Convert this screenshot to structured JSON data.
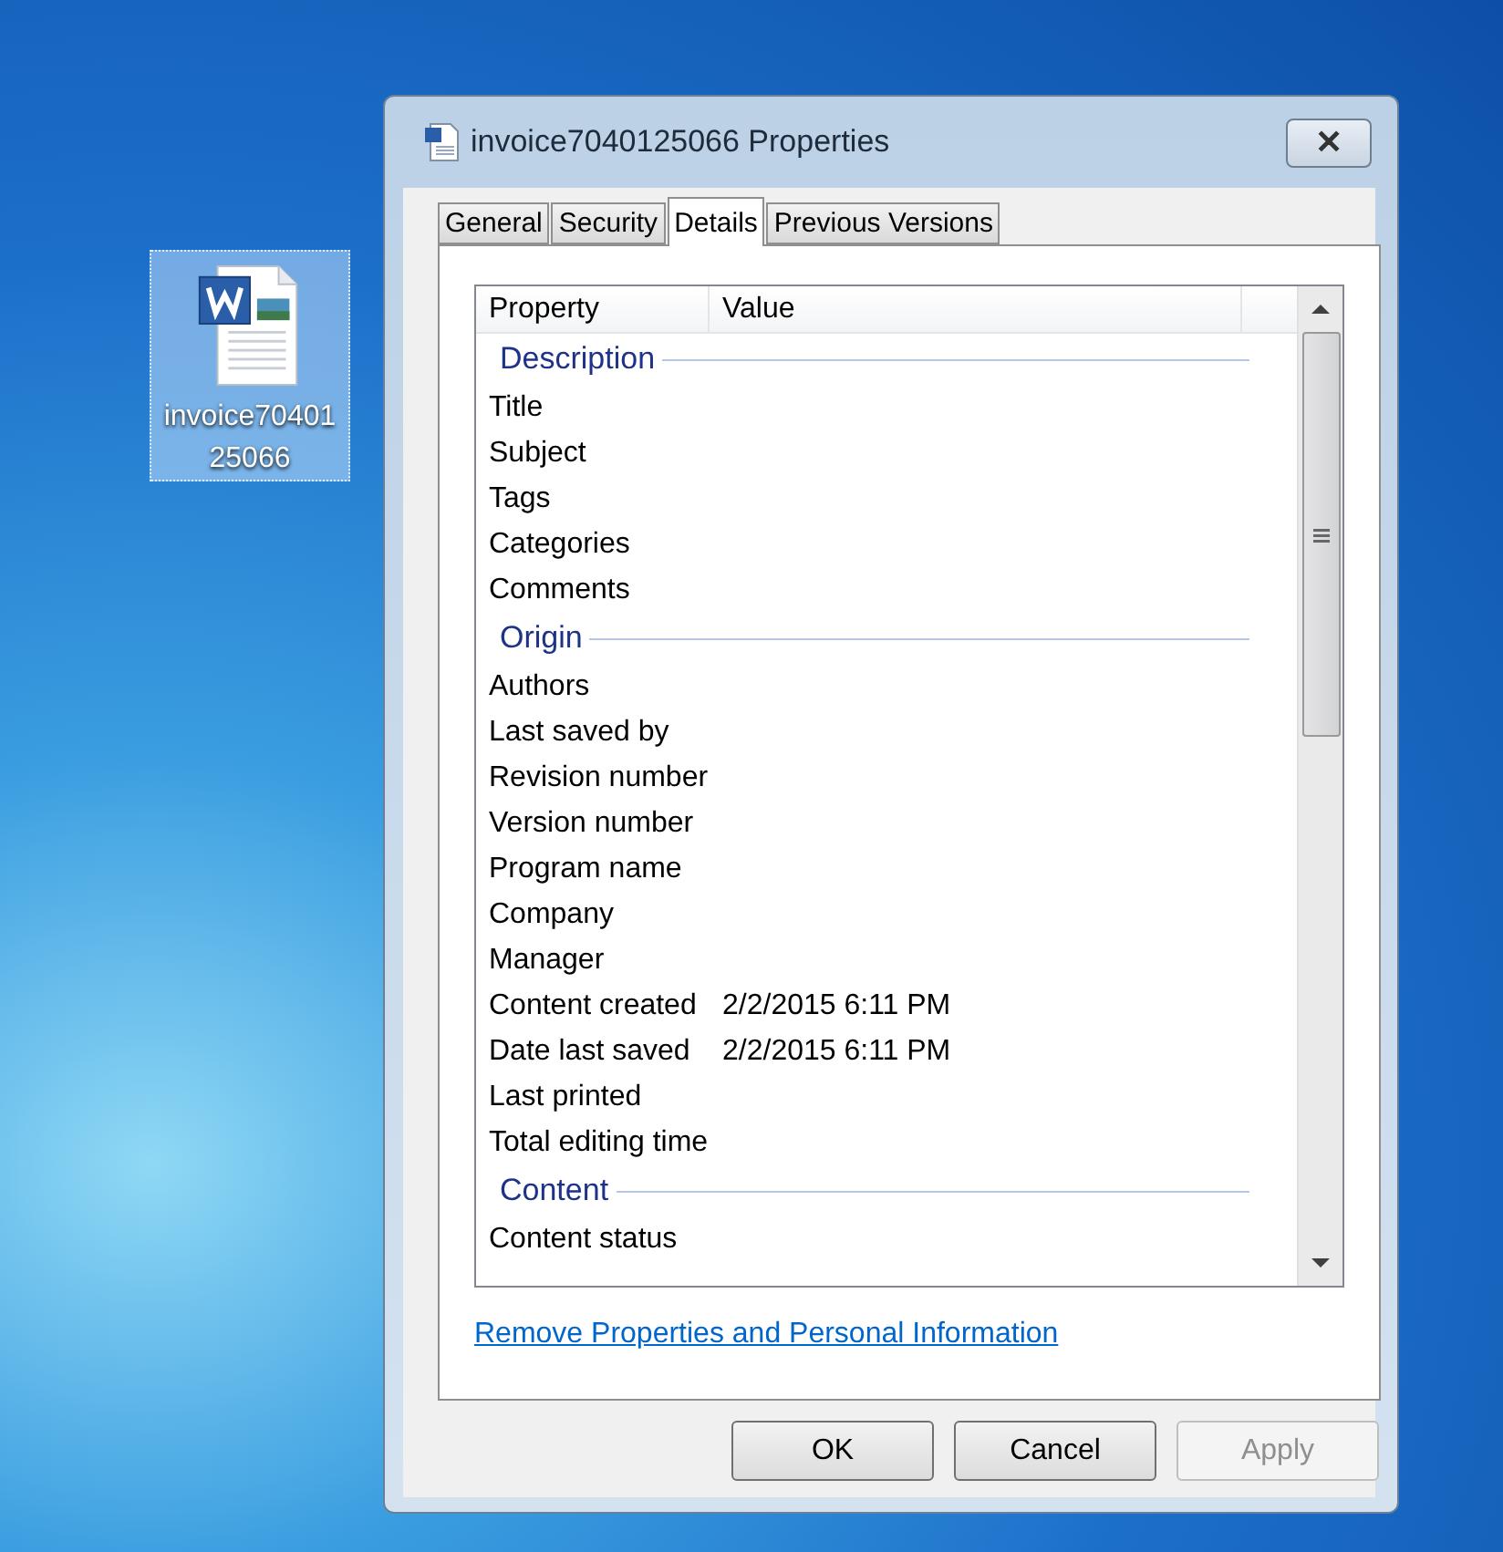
{
  "desktop_icon": {
    "label": "invoice7040125066",
    "selected": true
  },
  "window": {
    "title": "invoice7040125066 Properties",
    "close": "✕"
  },
  "tabs": [
    {
      "label": "General",
      "selected": false
    },
    {
      "label": "Security",
      "selected": false
    },
    {
      "label": "Details",
      "selected": true
    },
    {
      "label": "Previous Versions",
      "selected": false
    }
  ],
  "table": {
    "columns": [
      "Property",
      "Value"
    ],
    "sections": [
      {
        "heading": "Description",
        "rows": [
          {
            "property": "Title",
            "value": ""
          },
          {
            "property": "Subject",
            "value": ""
          },
          {
            "property": "Tags",
            "value": ""
          },
          {
            "property": "Categories",
            "value": ""
          },
          {
            "property": "Comments",
            "value": ""
          }
        ]
      },
      {
        "heading": "Origin",
        "rows": [
          {
            "property": "Authors",
            "value": ""
          },
          {
            "property": "Last saved by",
            "value": ""
          },
          {
            "property": "Revision number",
            "value": ""
          },
          {
            "property": "Version number",
            "value": ""
          },
          {
            "property": "Program name",
            "value": ""
          },
          {
            "property": "Company",
            "value": ""
          },
          {
            "property": "Manager",
            "value": ""
          },
          {
            "property": "Content created",
            "value": "2/2/2015 6:11 PM"
          },
          {
            "property": "Date last saved",
            "value": "2/2/2015 6:11 PM"
          },
          {
            "property": "Last printed",
            "value": ""
          },
          {
            "property": "Total editing time",
            "value": ""
          }
        ]
      },
      {
        "heading": "Content",
        "rows": [
          {
            "property": "Content status",
            "value": ""
          }
        ]
      }
    ]
  },
  "link": "Remove Properties and Personal Information",
  "buttons": [
    {
      "label": "OK",
      "disabled": false
    },
    {
      "label": "Cancel",
      "disabled": false
    },
    {
      "label": "Apply",
      "disabled": true
    }
  ]
}
